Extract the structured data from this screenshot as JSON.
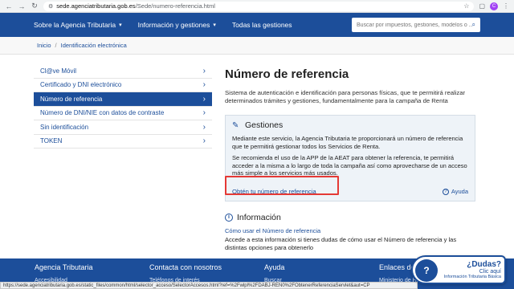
{
  "browser": {
    "domain": "sede.agenciatributaria.gob.es",
    "path": "/Sede/numero-referencia.html",
    "profile_initial": "C",
    "status_url": "https://sede.agenciatributaria.gob.es/static_files/common/html/selector_acceso/SelectorAccesos.html?ref=%2Fwlpl%2FDABJ-REN0%2FObtenerReferenciaServlet&aut=CP"
  },
  "topnav": {
    "items": [
      {
        "label": "Sobre la Agencia Tributaria"
      },
      {
        "label": "Información y gestiones"
      },
      {
        "label": "Todas las gestiones"
      }
    ],
    "search_placeholder": "Buscar por impuestos, gestiones, modelos o ..."
  },
  "breadcrumb": {
    "home": "Inicio",
    "current": "Identificación electrónica"
  },
  "sidebar": {
    "items": [
      {
        "label": "Cl@ve Móvil"
      },
      {
        "label": "Certificado y DNI electrónico"
      },
      {
        "label": "Número de referencia"
      },
      {
        "label": "Número de DNI/NIE con datos de contraste"
      },
      {
        "label": "Sin identificación"
      },
      {
        "label": "TOKEN"
      }
    ]
  },
  "main": {
    "title": "Número de referencia",
    "description": "Sistema de autenticación e identificación para personas físicas, que te permitirá realizar determinados trámites y gestiones, fundamentalmente para la campaña de Renta",
    "gestiones": {
      "title": "Gestiones",
      "p1": "Mediante este servicio, la Agencia Tributaria te proporcionará un número de referencia que te permitirá gestionar todos los Servicios de Renta.",
      "p2": "Se recomienda el uso de la APP de la AEAT para obtener la referencia, te permitirá acceder a la misma a lo largo de toda la campaña así como aprovecharse de un acceso más simple a los servicios más usados.",
      "link": "Obtén tu número de referencia",
      "help": "Ayuda"
    },
    "info": {
      "title": "Información",
      "link": "Cómo usar el Número de referencia",
      "text": "Accede a esta información si tienes dudas de cómo usar el Número de referencia y las distintas opciones para obtenerlo"
    }
  },
  "footer": {
    "cols": [
      {
        "title": "Agencia Tributaria",
        "sub": "Accesibilidad"
      },
      {
        "title": "Contacta con nosotros",
        "sub": "Teléfonos de interés"
      },
      {
        "title": "Ayuda",
        "sub": "Buscar"
      },
      {
        "title": "Enlaces de",
        "sub": "Ministerio de Hacienda"
      }
    ]
  },
  "chat_widget": {
    "title": "¿Dudas?",
    "cta": "Clic aquí",
    "subtitle": "Información Tributaria Básica"
  }
}
